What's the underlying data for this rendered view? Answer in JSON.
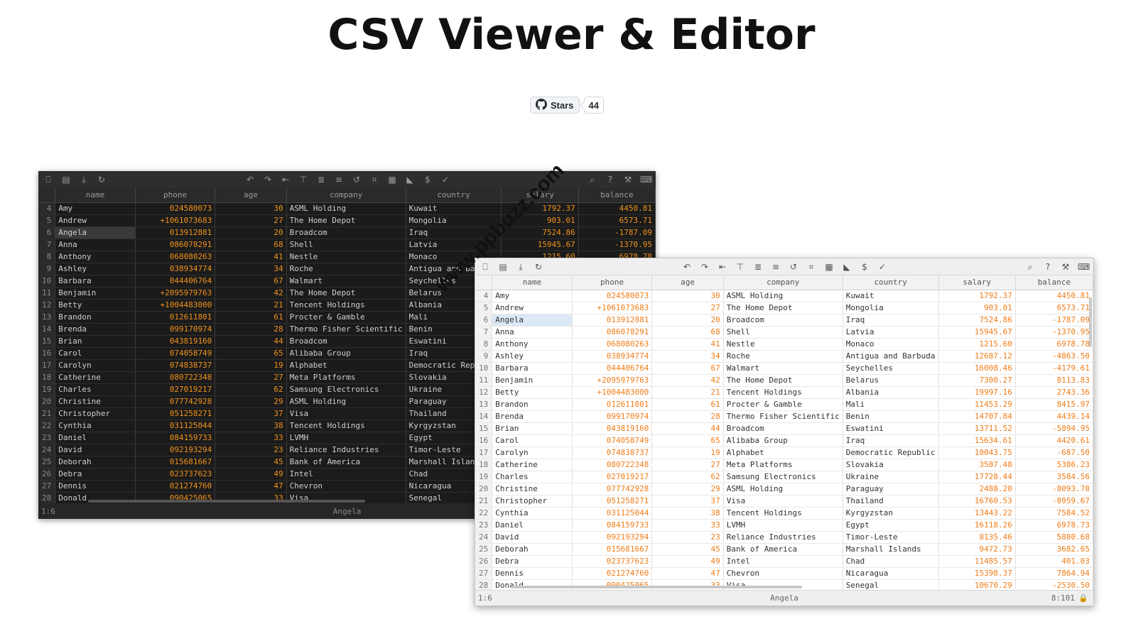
{
  "page": {
    "title": "CSV Viewer & Editor"
  },
  "stars": {
    "label": "Stars",
    "count": "44"
  },
  "watermark": "www.ppbuzz.com",
  "columns": [
    "name",
    "phone",
    "age",
    "company",
    "country",
    "salary",
    "balance"
  ],
  "rows": [
    {
      "n": "4",
      "name": "Amy",
      "phone": "024580073",
      "age": "30",
      "company": "ASML Holding",
      "country": "Kuwait",
      "salary": "1792.37",
      "balance": "4450.81"
    },
    {
      "n": "5",
      "name": "Andrew",
      "phone": "+1061073683",
      "age": "27",
      "company": "The Home Depot",
      "country": "Mongolia",
      "salary": "903.01",
      "balance": "6573.71"
    },
    {
      "n": "6",
      "name": "Angela",
      "phone": "013912881",
      "age": "20",
      "company": "Broadcom",
      "country": "Iraq",
      "salary": "7524.86",
      "balance": "-1787.09"
    },
    {
      "n": "7",
      "name": "Anna",
      "phone": "086078291",
      "age": "68",
      "company": "Shell",
      "country": "Latvia",
      "salary": "15945.67",
      "balance": "-1370.95"
    },
    {
      "n": "8",
      "name": "Anthony",
      "phone": "068080263",
      "age": "41",
      "company": "Nestle",
      "country": "Monaco",
      "salary": "1215.60",
      "balance": "6978.78"
    },
    {
      "n": "9",
      "name": "Ashley",
      "phone": "038934774",
      "age": "34",
      "company": "Roche",
      "country": "Antigua and Barbuda",
      "salary": "12687.12",
      "balance": "-4863.50"
    },
    {
      "n": "10",
      "name": "Barbara",
      "phone": "044406764",
      "age": "67",
      "company": "Walmart",
      "country": "Seychelles",
      "salary": "16008.46",
      "balance": "-4179.61"
    },
    {
      "n": "11",
      "name": "Benjamin",
      "phone": "+2095979763",
      "age": "42",
      "company": "The Home Depot",
      "country": "Belarus",
      "salary": "7300.27",
      "balance": "8113.83"
    },
    {
      "n": "12",
      "name": "Betty",
      "phone": "+1004483000",
      "age": "21",
      "company": "Tencent Holdings",
      "country": "Albania",
      "salary": "19997.16",
      "balance": "2743.36"
    },
    {
      "n": "13",
      "name": "Brandon",
      "phone": "012611801",
      "age": "61",
      "company": "Procter & Gamble",
      "country": "Mali",
      "salary": "11453.29",
      "balance": "8415.97"
    },
    {
      "n": "14",
      "name": "Brenda",
      "phone": "099170974",
      "age": "28",
      "company": "Thermo Fisher Scientific",
      "country": "Benin",
      "salary": "14707.84",
      "balance": "4439.14"
    },
    {
      "n": "15",
      "name": "Brian",
      "phone": "043819160",
      "age": "44",
      "company": "Broadcom",
      "country": "Eswatini",
      "salary": "13711.52",
      "balance": "-5894.95"
    },
    {
      "n": "16",
      "name": "Carol",
      "phone": "074058749",
      "age": "65",
      "company": "Alibaba Group",
      "country": "Iraq",
      "salary": "15634.61",
      "balance": "4420.61"
    },
    {
      "n": "17",
      "name": "Carolyn",
      "phone": "074838737",
      "age": "19",
      "company": "Alphabet",
      "country": "Democratic Republic",
      "salary": "10043.75",
      "balance": "-687.50"
    },
    {
      "n": "18",
      "name": "Catherine",
      "phone": "080722348",
      "age": "27",
      "company": "Meta Platforms",
      "country": "Slovakia",
      "salary": "3587.48",
      "balance": "5386.23"
    },
    {
      "n": "19",
      "name": "Charles",
      "phone": "027019217",
      "age": "62",
      "company": "Samsung Electronics",
      "country": "Ukraine",
      "salary": "17728.44",
      "balance": "3584.56"
    },
    {
      "n": "20",
      "name": "Christine",
      "phone": "077742928",
      "age": "29",
      "company": "ASML Holding",
      "country": "Paraguay",
      "salary": "2488.20",
      "balance": "-8093.78"
    },
    {
      "n": "21",
      "name": "Christopher",
      "phone": "051258271",
      "age": "37",
      "company": "Visa",
      "country": "Thailand",
      "salary": "16760.53",
      "balance": "-8959.67"
    },
    {
      "n": "22",
      "name": "Cynthia",
      "phone": "031125044",
      "age": "38",
      "company": "Tencent Holdings",
      "country": "Kyrgyzstan",
      "salary": "13443.22",
      "balance": "7584.52"
    },
    {
      "n": "23",
      "name": "Daniel",
      "phone": "084159733",
      "age": "33",
      "company": "LVMH",
      "country": "Egypt",
      "salary": "16118.26",
      "balance": "6978.73"
    },
    {
      "n": "24",
      "name": "David",
      "phone": "092193294",
      "age": "23",
      "company": "Reliance Industries",
      "country": "Timor-Leste",
      "salary": "8135.46",
      "balance": "5880.68"
    },
    {
      "n": "25",
      "name": "Deborah",
      "phone": "015681667",
      "age": "45",
      "company": "Bank of America",
      "country": "Marshall Islands",
      "salary": "9472.73",
      "balance": "3682.65"
    },
    {
      "n": "26",
      "name": "Debra",
      "phone": "023737623",
      "age": "49",
      "company": "Intel",
      "country": "Chad",
      "salary": "11485.57",
      "balance": "401.03"
    },
    {
      "n": "27",
      "name": "Dennis",
      "phone": "021274760",
      "age": "47",
      "company": "Chevron",
      "country": "Nicaragua",
      "salary": "15398.37",
      "balance": "7864.94"
    },
    {
      "n": "28",
      "name": "Donald",
      "phone": "090425065",
      "age": "33",
      "company": "Visa",
      "country": "Senegal",
      "salary": "10670.29",
      "balance": "-2530.50"
    }
  ],
  "selected_row": "6",
  "status": {
    "position": "1:6",
    "value": "Angela",
    "total": "8:101"
  },
  "toolbar": {
    "left": [
      "new-file-icon",
      "open-folder-icon",
      "download-icon",
      "reload-icon"
    ],
    "center": [
      "undo-icon",
      "redo-icon",
      "align-left-icon",
      "align-top-icon",
      "filter-icon",
      "align-middle-icon",
      "transform-icon",
      "crop-icon",
      "calendar-icon",
      "triangle-ruler-icon",
      "dollar-icon",
      "spellcheck-icon"
    ],
    "right": [
      "search-icon",
      "help-icon",
      "wrench-icon",
      "keyboard-icon"
    ]
  },
  "colors": {
    "orange_number": "#f0921c",
    "dark_bg": "#1b1b1b",
    "light_bg": "#ffffff",
    "selection_light": "#dbe8f6"
  }
}
